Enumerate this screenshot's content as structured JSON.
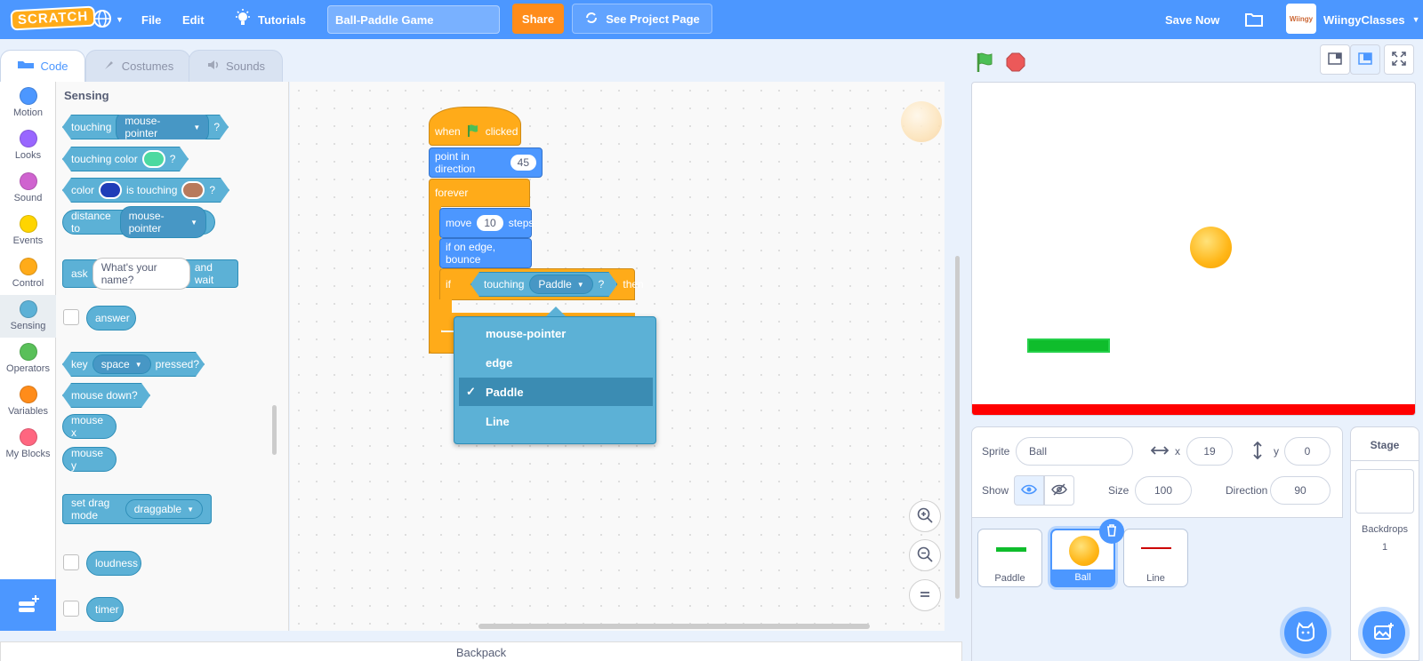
{
  "menubar": {
    "logo": "SCRATCH",
    "file": "File",
    "edit": "Edit",
    "tutorials": "Tutorials",
    "project_title": "Ball-Paddle Game",
    "share": "Share",
    "see_project_page": "See Project Page",
    "save_now": "Save Now",
    "avatar_text": "Wiingy",
    "username": "WiingyClasses"
  },
  "tabs": {
    "code": "Code",
    "costumes": "Costumes",
    "sounds": "Sounds"
  },
  "categories": [
    {
      "label": "Motion",
      "color": "#4c97ff"
    },
    {
      "label": "Looks",
      "color": "#9966ff"
    },
    {
      "label": "Sound",
      "color": "#cf63cf"
    },
    {
      "label": "Events",
      "color": "#ffd500"
    },
    {
      "label": "Control",
      "color": "#ffab19"
    },
    {
      "label": "Sensing",
      "color": "#5cb1d6"
    },
    {
      "label": "Operators",
      "color": "#59c059"
    },
    {
      "label": "Variables",
      "color": "#ff8c1a"
    },
    {
      "label": "My Blocks",
      "color": "#ff6680"
    }
  ],
  "palette": {
    "heading": "Sensing",
    "touching": "touching",
    "touching_field": "mouse-pointer",
    "question": "?",
    "touching_color": "touching color",
    "color": "color",
    "is_touching": "is touching",
    "distance_to": "distance to",
    "distance_field": "mouse-pointer",
    "ask": "ask",
    "ask_field": "What's your name?",
    "and_wait": "and wait",
    "answer": "answer",
    "key": "key",
    "key_field": "space",
    "pressed": "pressed?",
    "mouse_down": "mouse down?",
    "mouse_x": "mouse x",
    "mouse_y": "mouse y",
    "set_drag_mode": "set drag mode",
    "drag_field": "draggable",
    "loudness": "loudness",
    "timer": "timer",
    "colors": {
      "touching_color": "#4cd9a0",
      "color1": "#1f3db8",
      "color2": "#b87a5c"
    }
  },
  "script": {
    "when": "when",
    "clicked": "clicked",
    "point_in_direction": "point in direction",
    "direction_value": "45",
    "forever": "forever",
    "move": "move",
    "move_value": "10",
    "steps": "steps",
    "bounce": "if on edge, bounce",
    "if": "if",
    "touching": "touching",
    "touching_field": "Paddle",
    "question": "?",
    "then": "then"
  },
  "dropdown": {
    "options": [
      "mouse-pointer",
      "edge",
      "Paddle",
      "Line"
    ],
    "selected": "Paddle",
    "check": "✓"
  },
  "backpack": "Backpack",
  "sprite_info": {
    "sprite_label": "Sprite",
    "sprite_name": "Ball",
    "x_label": "x",
    "x_value": "19",
    "y_label": "y",
    "y_value": "0",
    "show_label": "Show",
    "size_label": "Size",
    "size_value": "100",
    "direction_label": "Direction",
    "direction_value": "90"
  },
  "sprites": [
    {
      "name": "Paddle",
      "selected": false
    },
    {
      "name": "Ball",
      "selected": true
    },
    {
      "name": "Line",
      "selected": false
    }
  ],
  "stage_pane": {
    "title": "Stage",
    "backdrops_label": "Backdrops",
    "backdrops_count": "1"
  },
  "icons": [
    "globe-icon",
    "bulb-icon",
    "remix-icon",
    "folder-icon",
    "green-flag-icon",
    "stop-icon",
    "small-stage-icon",
    "large-stage-icon",
    "fullscreen-icon",
    "zoom-in-icon",
    "zoom-out-icon",
    "zoom-reset-icon",
    "show-eye-icon",
    "hide-eye-icon",
    "delete-icon",
    "add-extension-icon",
    "choose-sprite-icon",
    "choose-backdrop-icon"
  ],
  "colors": {
    "brand": "#4c97ff",
    "share": "#ff8c1a",
    "sensing": "#5cb1d6",
    "events": "#ffab19",
    "motion": "#4c97ff",
    "paddle": "#0fbd2c",
    "floor_line": "#ff0000"
  }
}
